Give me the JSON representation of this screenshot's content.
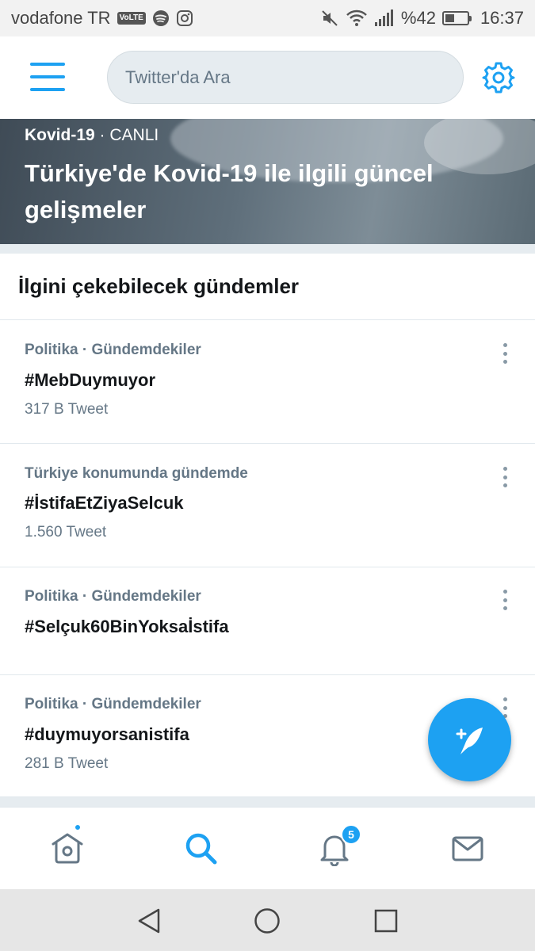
{
  "status_bar": {
    "carrier": "vodafone TR",
    "volte": "VoLTE",
    "battery_text": "%42",
    "battery_level": 0.42,
    "time": "16:37"
  },
  "header": {
    "search_placeholder": "Twitter'da Ara",
    "menu_icon": "hamburger-icon",
    "settings_icon": "gear-icon"
  },
  "banner": {
    "topic": "Kovid-19",
    "separator": " · ",
    "live_label": "CANLI",
    "title": "Türkiye'de Kovid-19 ile ilgili güncel gelişmeler"
  },
  "section": {
    "title": "İlgini çekebilecek gündemler"
  },
  "trends": [
    {
      "meta": "Politika · Gündemdekiler",
      "name": "#MebDuymuyor",
      "count": "317 B Tweet"
    },
    {
      "meta": "Türkiye konumunda gündemde",
      "name": "#İstifaEtZiyaSelcuk",
      "count": "1.560 Tweet"
    },
    {
      "meta": "Politika · Gündemdekiler",
      "name": "#Selçuk60BinYoksaİstifa",
      "count": ""
    },
    {
      "meta": "Politika · Gündemdekiler",
      "name": "#duymuyorsanistifa",
      "count": "281 B Tweet"
    }
  ],
  "bottom_nav": {
    "notification_count": "5",
    "items": [
      "home-icon",
      "search-icon",
      "bell-icon",
      "mail-icon"
    ]
  },
  "colors": {
    "accent": "#1da1f2",
    "secondary_text": "#657786",
    "primary_text": "#14171a"
  }
}
